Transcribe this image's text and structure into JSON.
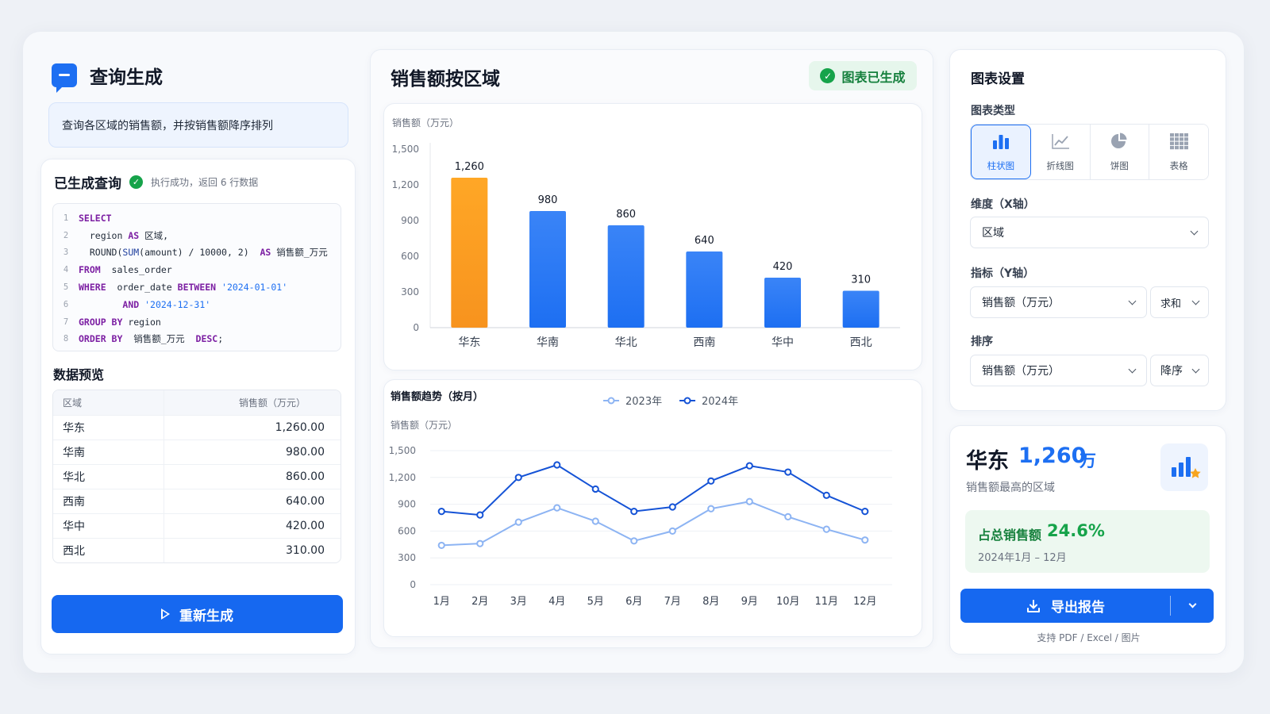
{
  "query_panel": {
    "title": "查询生成",
    "prompt": "查询各区域的销售额，并按销售额降序排列",
    "generated_title": "已生成查询",
    "status": "执行成功，返回 6 行数据",
    "sql_lines": [
      {
        "no": "1",
        "tokens": [
          [
            "kw",
            "SELECT"
          ]
        ]
      },
      {
        "no": "2",
        "tokens": [
          [
            "txt",
            "  region "
          ],
          [
            "kw",
            "AS"
          ],
          [
            "txt",
            " 区域,"
          ]
        ]
      },
      {
        "no": "3",
        "tokens": [
          [
            "txt",
            "  ROUND("
          ],
          [
            "fn",
            "SUM"
          ],
          [
            "txt",
            "(amount) / 10000, 2)  "
          ],
          [
            "kw",
            "AS"
          ],
          [
            "txt",
            " 销售额_万元"
          ]
        ]
      },
      {
        "no": "4",
        "tokens": [
          [
            "kw",
            "FROM"
          ],
          [
            "txt",
            "  sales_order"
          ]
        ]
      },
      {
        "no": "5",
        "tokens": [
          [
            "kw",
            "WHERE"
          ],
          [
            "txt",
            "  order_date "
          ],
          [
            "kw",
            "BETWEEN"
          ],
          [
            "str",
            " '2024-01-01'"
          ]
        ]
      },
      {
        "no": "6",
        "tokens": [
          [
            "txt",
            "        "
          ],
          [
            "kw",
            "AND"
          ],
          [
            "str",
            " '2024-12-31'"
          ]
        ]
      },
      {
        "no": "7",
        "tokens": [
          [
            "kw",
            "GROUP BY"
          ],
          [
            "txt",
            " region"
          ]
        ]
      },
      {
        "no": "8",
        "tokens": [
          [
            "kw",
            "ORDER BY"
          ],
          [
            "txt",
            "  销售额_万元  "
          ],
          [
            "kw",
            "DESC"
          ],
          [
            "txt",
            ";"
          ]
        ]
      }
    ],
    "preview_title": "数据预览",
    "table_headers": [
      "区域",
      "销售额（万元）"
    ],
    "table_rows": [
      [
        "华东",
        "1,260.00"
      ],
      [
        "华南",
        "980.00"
      ],
      [
        "华北",
        "860.00"
      ],
      [
        "西南",
        "640.00"
      ],
      [
        "华中",
        "420.00"
      ],
      [
        "西北",
        "310.00"
      ]
    ],
    "regenerate_label": "重新生成"
  },
  "chart_panel": {
    "title": "销售额按区域",
    "badge": "图表已生成"
  },
  "chart_data": [
    {
      "type": "bar",
      "ylabel": "销售额（万元）",
      "categories": [
        "华东",
        "华南",
        "华北",
        "西南",
        "华中",
        "西北"
      ],
      "values": [
        1260,
        980,
        860,
        640,
        420,
        310
      ],
      "value_labels": [
        "1,260",
        "980",
        "860",
        "640",
        "420",
        "310"
      ],
      "highlight_index": 0,
      "highlight_color": "#f7931e",
      "bar_color": "#1d6ff2",
      "ylim": [
        0,
        1500
      ],
      "yticks": [
        "0",
        "300",
        "600",
        "900",
        "1,200",
        "1,500"
      ]
    },
    {
      "type": "line",
      "title": "销售额趋势（按月）",
      "ylabel": "销售额（万元）",
      "categories": [
        "1月",
        "2月",
        "3月",
        "4月",
        "5月",
        "6月",
        "7月",
        "8月",
        "9月",
        "10月",
        "11月",
        "12月"
      ],
      "series": [
        {
          "name": "2023年",
          "color": "#8db4f3",
          "values": [
            440,
            460,
            700,
            860,
            710,
            490,
            600,
            850,
            930,
            760,
            620,
            500
          ]
        },
        {
          "name": "2024年",
          "color": "#1553d6",
          "values": [
            820,
            780,
            1200,
            1340,
            1070,
            820,
            870,
            1160,
            1330,
            1260,
            1000,
            820
          ]
        }
      ],
      "ylim": [
        0,
        1500
      ],
      "yticks": [
        "0",
        "300",
        "600",
        "900",
        "1,200",
        "1,500"
      ],
      "legend": "top"
    }
  ],
  "settings": {
    "title": "图表设置",
    "type_label": "图表类型",
    "types": [
      {
        "label": "柱状图",
        "icon": "bar-chart-icon",
        "active": true
      },
      {
        "label": "折线图",
        "icon": "line-chart-icon",
        "active": false
      },
      {
        "label": "饼图",
        "icon": "pie-chart-icon",
        "active": false
      },
      {
        "label": "表格",
        "icon": "table-icon",
        "active": false
      }
    ],
    "dimension_label": "维度（X轴）",
    "dimension_value": "区域",
    "metric_label": "指标（Y轴）",
    "metric_value": "销售额（万元）",
    "aggregation_value": "求和",
    "sort_label": "排序",
    "sort_field_value": "销售额（万元）",
    "sort_order_value": "降序"
  },
  "highlight": {
    "region": "华东",
    "value": "1,260",
    "unit": "万",
    "subtitle": "销售额最高的区域",
    "share_label": "占总销售额",
    "share_value": "24.6%",
    "range": "2024年1月 – 12月",
    "export_label": "导出报告",
    "export_note": "支持 PDF / Excel / 图片"
  },
  "colors": {
    "accent": "#1668f0",
    "success": "#16a34a",
    "highlight": "#f7931e"
  }
}
